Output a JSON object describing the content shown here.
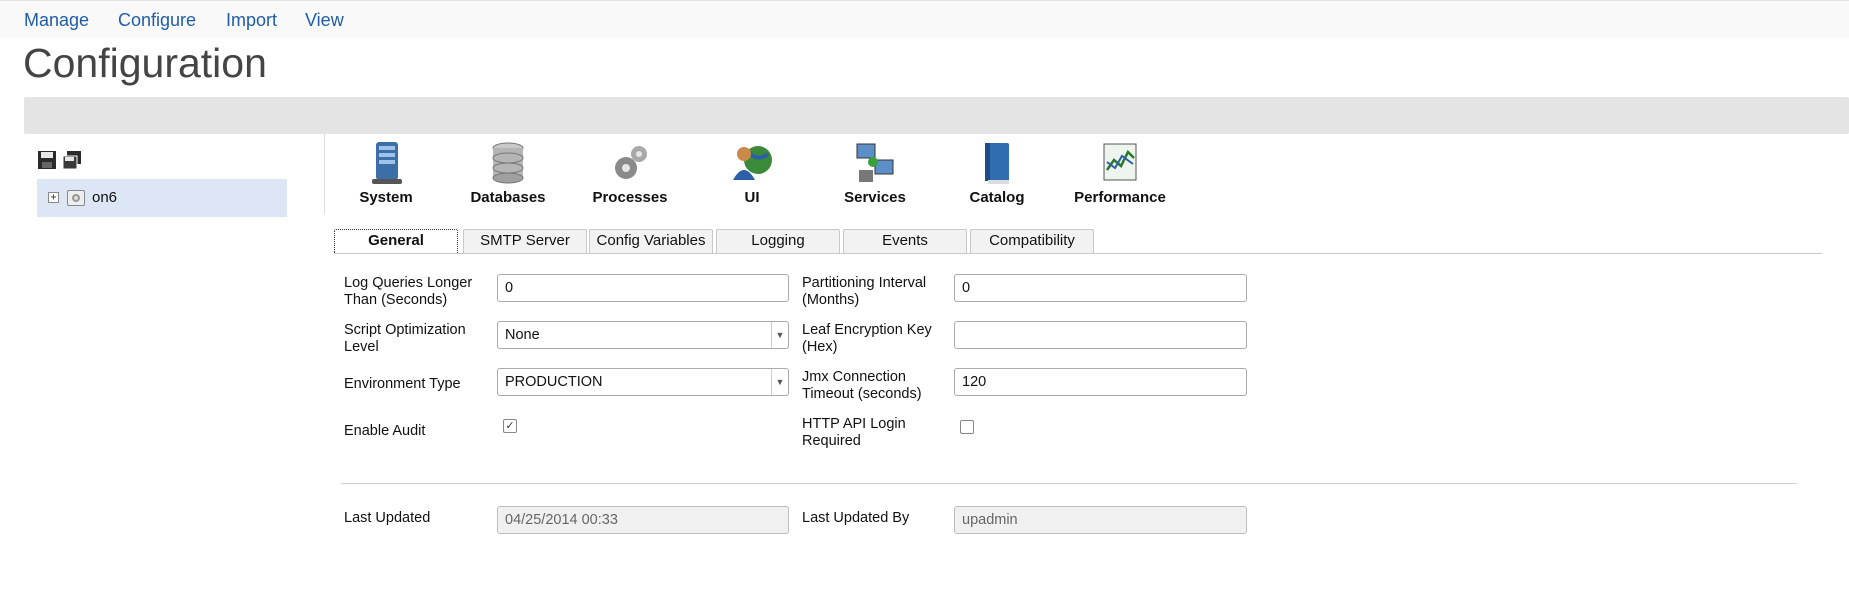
{
  "nav": {
    "manage": "Manage",
    "configure": "Configure",
    "import": "Import",
    "view": "View"
  },
  "page_title": "Configuration",
  "tree": {
    "node_label": "on6",
    "expander": "+"
  },
  "categories": {
    "system": "System",
    "databases": "Databases",
    "processes": "Processes",
    "ui": "UI",
    "services": "Services",
    "catalog": "Catalog",
    "performance": "Performance"
  },
  "tabs": {
    "general": "General",
    "smtp": "SMTP Server",
    "config_vars": "Config Variables",
    "logging": "Logging",
    "events": "Events",
    "compatibility": "Compatibility"
  },
  "form": {
    "log_queries_label": "Log Queries Longer Than (Seconds)",
    "log_queries_value": "0",
    "partitioning_label": "Partitioning Interval (Months)",
    "partitioning_value": "0",
    "script_opt_label": "Script Optimization Level",
    "script_opt_value": "None",
    "leaf_key_label": "Leaf Encryption Key (Hex)",
    "leaf_key_value": "",
    "env_type_label": "Environment Type",
    "env_type_value": "PRODUCTION",
    "jmx_label": "Jmx Connection Timeout (seconds)",
    "jmx_value": "120",
    "enable_audit_label": "Enable Audit",
    "enable_audit_checked": true,
    "http_login_label": "HTTP API Login Required",
    "http_login_checked": false,
    "last_updated_label": "Last Updated",
    "last_updated_value": "04/25/2014 00:33",
    "last_updated_by_label": "Last Updated By",
    "last_updated_by_value": "upadmin"
  },
  "colors": {
    "link": "#1f5da8",
    "selected_node_bg": "#dce6f4",
    "header_bar": "#e4e4e4"
  }
}
